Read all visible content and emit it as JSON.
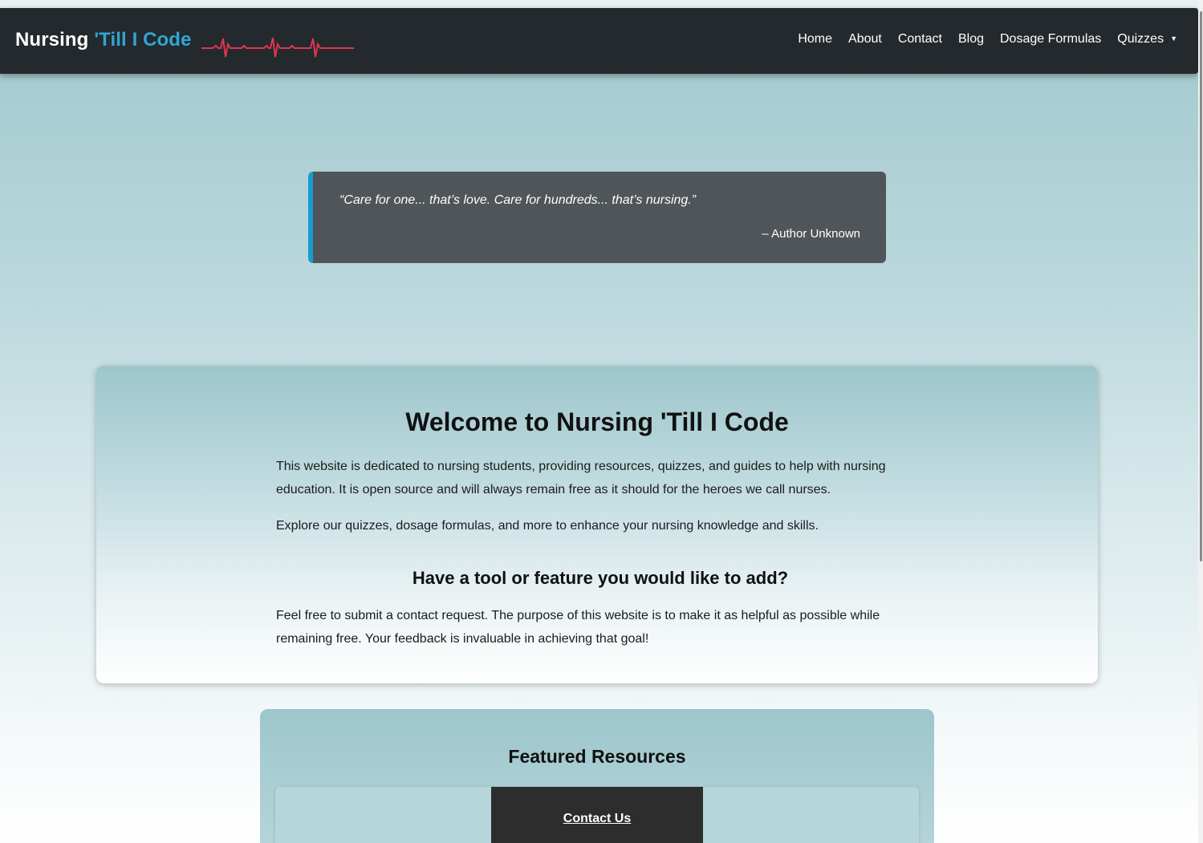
{
  "navbar": {
    "brand_part1": "Nursing",
    "brand_part2": "'Till I Code",
    "links": [
      "Home",
      "About",
      "Contact",
      "Blog",
      "Dosage Formulas",
      "Quizzes"
    ],
    "dropdown_caret": "▼"
  },
  "quote": {
    "text": "“Care for one... that’s love. Care for hundreds... that’s nursing.”",
    "author": "– Author Unknown"
  },
  "welcome": {
    "title": "Welcome to Nursing 'Till I Code",
    "paragraph1": "This website is dedicated to nursing students, providing resources, quizzes, and guides to help with nursing education. It is open source and will always remain free as it should for the heroes we call nurses.",
    "paragraph2": "Explore our quizzes, dosage formulas, and more to enhance your nursing knowledge and skills.",
    "subtitle": "Have a tool or feature you would like to add?",
    "paragraph3": "Feel free to submit a contact request. The purpose of this website is to make it as helpful as possible while remaining free. Your feedback is invaluable in achieving that goal!"
  },
  "featured": {
    "title": "Featured Resources",
    "contact_link": "Contact Us"
  },
  "colors": {
    "navbar_bg": "#23292c",
    "brand_accent": "#2fa6d4",
    "ecg_line": "#e03553",
    "quote_border": "#189bd0",
    "quote_bg": "#4f5558"
  },
  "icons": {
    "heartbeat": "ecg-heartbeat-icon",
    "dropdown": "caret-down-icon"
  }
}
